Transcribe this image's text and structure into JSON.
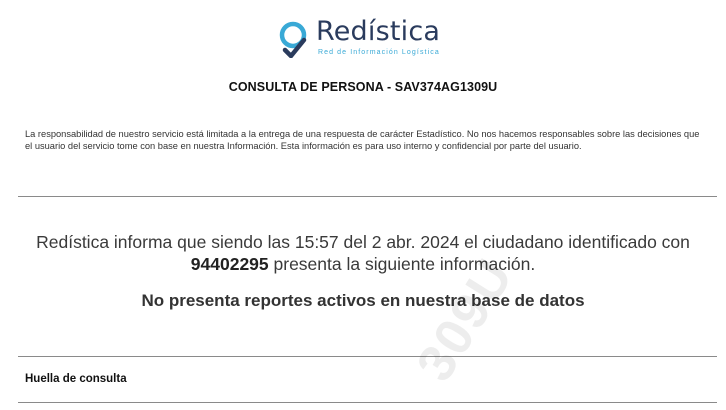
{
  "header": {
    "brand_name": "Redística",
    "tagline": "Red de Información Logística",
    "brand_color": "#2a3b5d",
    "accent_color": "#39a9d6",
    "logo_icon": "location-pin-check-icon"
  },
  "document": {
    "title": "CONSULTA DE PERSONA - SAV374AG1309U",
    "disclaimer": "La responsabilidad de nuestro servicio está limitada a la entrega de una respuesta de carácter Estadístico. No nos hacemos responsables sobre las decisiones que el usuario del servicio tome con base en nuestra Información. Esta información es para uso interno y confidencial por parte del usuario."
  },
  "report": {
    "statement_part1": "Redística informa que siendo las 15:57 del 2 abr. 2024 el ciudadano identificado con ",
    "citizen_id": "94402295",
    "statement_part2": " presenta la siguiente información.",
    "result": "No presenta reportes activos en nuestra base de datos"
  },
  "footprint": {
    "label": "Huella de consulta"
  },
  "watermark": {
    "text_1": "309U",
    "text_2": "309U"
  }
}
